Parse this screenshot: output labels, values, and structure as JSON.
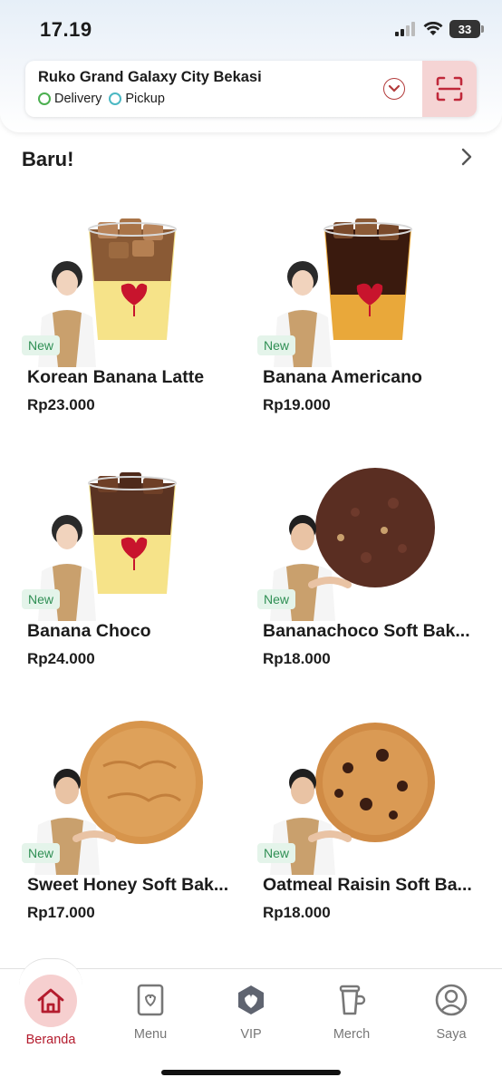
{
  "status_bar": {
    "time": "17.19",
    "battery": "33"
  },
  "location": {
    "store_name": "Ruko Grand Galaxy City Bekasi",
    "modes": [
      "Delivery",
      "Pickup"
    ]
  },
  "section": {
    "title": "Baru!"
  },
  "products": [
    {
      "name": "Korean Banana Latte",
      "price": "Rp23.000",
      "badge": "New",
      "image": "iced-latte-banana"
    },
    {
      "name": "Banana Americano",
      "price": "Rp19.000",
      "badge": "New",
      "image": "iced-americano"
    },
    {
      "name": "Banana Choco",
      "price": "Rp24.000",
      "badge": "New",
      "image": "iced-choco-banana"
    },
    {
      "name": "Bananachoco Soft Bak...",
      "price": "Rp18.000",
      "badge": "New",
      "image": "choco-cookie"
    },
    {
      "name": "Sweet Honey Soft Bak...",
      "price": "Rp17.000",
      "badge": "New",
      "image": "honey-cookie"
    },
    {
      "name": "Oatmeal Raisin Soft Ba...",
      "price": "Rp18.000",
      "badge": "New",
      "image": "oatmeal-cookie"
    }
  ],
  "bottom_nav": [
    {
      "label": "Beranda",
      "icon": "home-icon",
      "active": true
    },
    {
      "label": "Menu",
      "icon": "menu-icon",
      "active": false
    },
    {
      "label": "VIP",
      "icon": "vip-icon",
      "active": false
    },
    {
      "label": "Merch",
      "icon": "merch-cup-icon",
      "active": false
    },
    {
      "label": "Saya",
      "icon": "profile-icon",
      "active": false
    }
  ],
  "colors": {
    "brand_red": "#b41c2e",
    "new_badge_bg": "#e4f4ea",
    "new_badge_text": "#2f8f54"
  }
}
